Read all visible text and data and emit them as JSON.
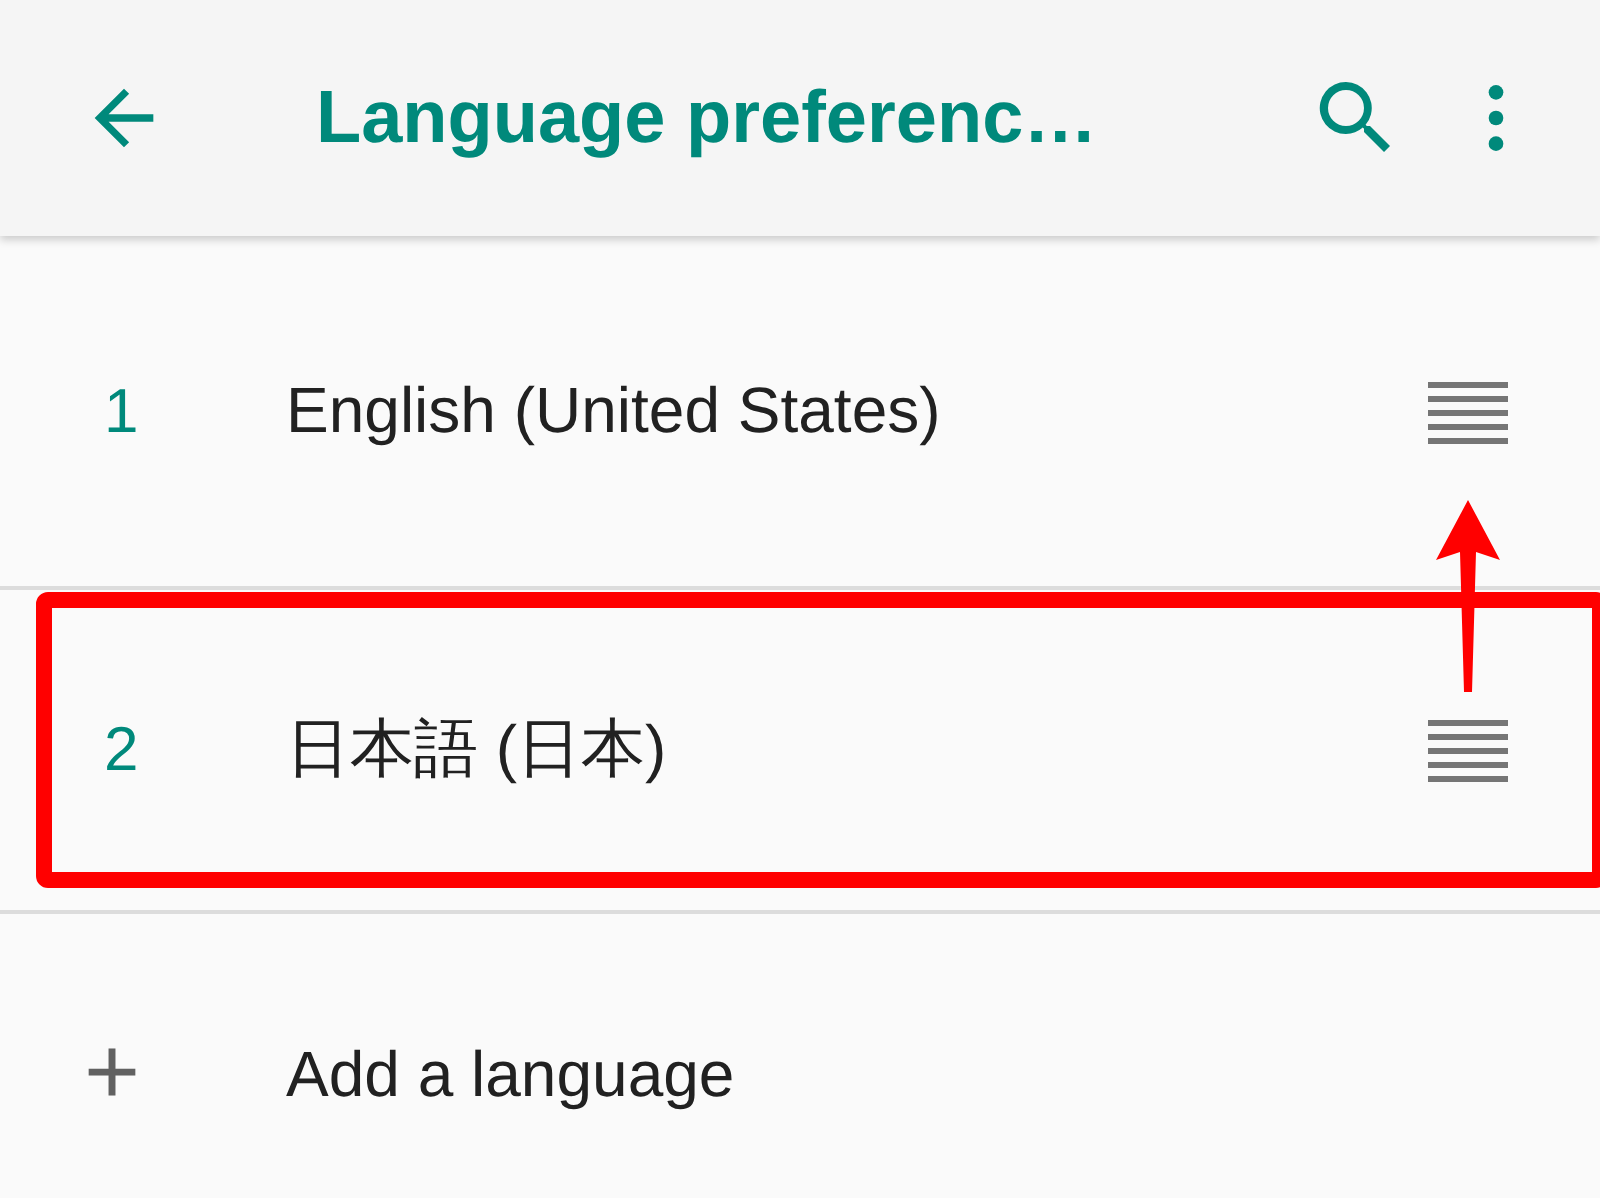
{
  "app_bar": {
    "title": "Language preferenc…"
  },
  "languages": [
    {
      "number": "1",
      "name": "English (United States)"
    },
    {
      "number": "2",
      "name": "日本語 (日本)"
    }
  ],
  "add_item": {
    "icon": "+",
    "label": "Add a language"
  }
}
